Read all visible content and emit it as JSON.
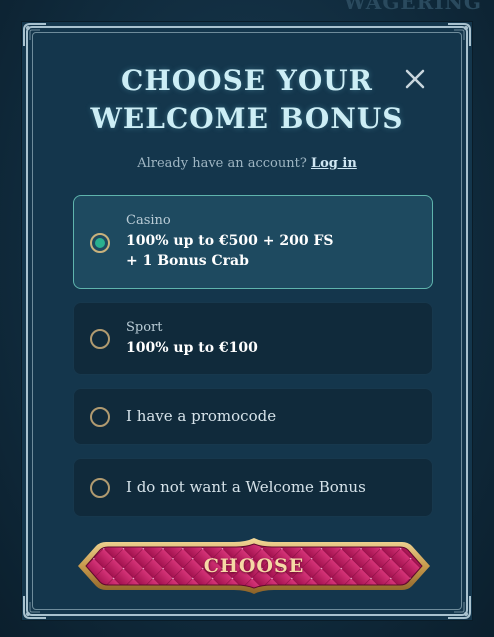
{
  "backdrop": {
    "partial_heading": "WAGERING"
  },
  "modal": {
    "title_line1": "CHOOSE YOUR",
    "title_line2": "WELCOME BONUS",
    "close_icon": "close-icon",
    "login_prompt": "Already have an account?",
    "login_link": "Log in",
    "options": [
      {
        "category": "Casino",
        "line1": "100% up to €500 + 200 FS",
        "line2": "+ 1 Bonus Crab",
        "selected": true
      },
      {
        "category": "Sport",
        "line1": "100% up to €100",
        "selected": false
      },
      {
        "label": "I have a promocode",
        "selected": false
      },
      {
        "label": "I do not want a Welcome Bonus",
        "selected": false
      }
    ],
    "choose_button": "CHOOSE"
  },
  "colors": {
    "accent_teal": "#5fb4ad",
    "button_magenta": "#b3185e",
    "gold": "#d9b66e"
  }
}
